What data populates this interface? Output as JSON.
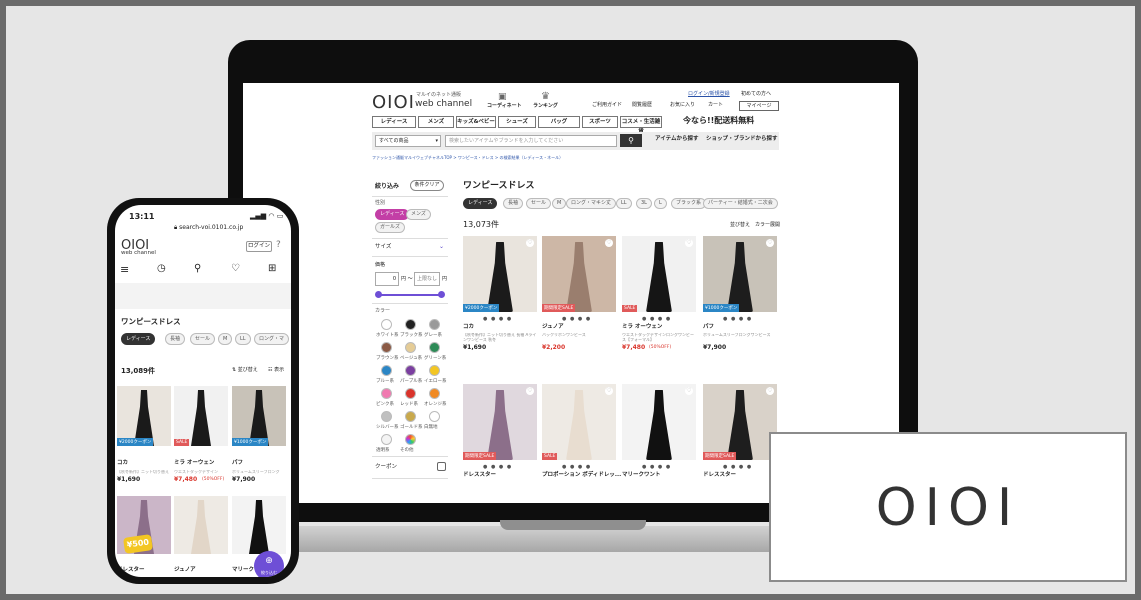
{
  "brand": {
    "logo": "OIOI",
    "sub": "web channel",
    "tag": "マルイのネット通販"
  },
  "desktop": {
    "header_links": [
      "ログイン/新規登録",
      "初めての方へ"
    ],
    "tools": [
      "コーディネート",
      "ランキング"
    ],
    "util": [
      "ご利用ガイド",
      "閲覧履歴",
      "お気に入り",
      "カート",
      "マイページ"
    ],
    "nav": [
      "レディース",
      "メンズ",
      "キッズ&ベビー",
      "シューズ",
      "バッグ",
      "スポーツ",
      "コスメ・生活雑貨"
    ],
    "shipping": "今なら!!配送料無料",
    "category_select": "すべての商品",
    "search_placeholder": "検索したいアイテムやブランドを入力してください",
    "search_links": [
      "アイテムから探す",
      "ショップ・ブランドから探す"
    ],
    "breadcrumb": "ファッション通販マルイウェブチャネルTOP > ワンピース・ドレス > の検索結果（レディース・ネール）",
    "filter_title": "絞り込み",
    "filter_clear": "条件クリア",
    "gender_label": "性別",
    "gender_tags": [
      "レディース",
      "メンズ",
      "ガールズ"
    ],
    "size_label": "サイズ",
    "price_label": "価格",
    "price_min": "0",
    "price_sep": "円 〜",
    "price_max": "上限なし",
    "price_unit": "円",
    "color_label": "カラー",
    "colors": [
      {
        "name": "ホワイト系",
        "hex": "#ffffff"
      },
      {
        "name": "ブラック系",
        "hex": "#222222"
      },
      {
        "name": "グレー系",
        "hex": "#999999"
      },
      {
        "name": "ブラウン系",
        "hex": "#8b5a45"
      },
      {
        "name": "ベージュ系",
        "hex": "#e5cc96"
      },
      {
        "name": "グリーン系",
        "hex": "#2e8b57"
      },
      {
        "name": "ブルー系",
        "hex": "#2b86c5"
      },
      {
        "name": "パープル系",
        "hex": "#7b3fa0"
      },
      {
        "name": "イエロー系",
        "hex": "#f3c623"
      },
      {
        "name": "ピンク系",
        "hex": "#f07ab0"
      },
      {
        "name": "レッド系",
        "hex": "#d9342b"
      },
      {
        "name": "オレンジ系",
        "hex": "#f08a24"
      },
      {
        "name": "シルバー系",
        "hex": "#c0c0c0"
      },
      {
        "name": "ゴールド系",
        "hex": "#c9a94c"
      },
      {
        "name": "白無地",
        "hex": "#ffffff"
      },
      {
        "name": "透明系",
        "hex": "#f4f4f4"
      },
      {
        "name": "その他",
        "hex": "#ff9f43"
      }
    ],
    "coupon_label": "クーポン",
    "page_title": "ワンピースドレス",
    "chips": [
      "レディース",
      "長袖",
      "セール",
      "M",
      "ロング・マキシ丈",
      "LL",
      "3L",
      "L",
      "ブラック系",
      "パーティー・結婚式・二次会"
    ],
    "result_count": "13,073件",
    "sort_links": [
      "並び替え",
      "カラー展開"
    ],
    "products": [
      {
        "brand": "コカ",
        "desc": "【秋冬新作】ニット切り替え 長袖 Aラインワンピース 秋冬",
        "price": "¥1,690",
        "discount": "",
        "badge": "¥2000クーポン",
        "badge_color": "#2b86c5",
        "bg": "#e9e4dd",
        "dress": "#1b1b1b"
      },
      {
        "brand": "ジュノア",
        "desc": "バックリボンワンピース",
        "price": "¥2,200",
        "discount": "",
        "badge": "期間限定SALE",
        "badge_color": "#e05a5a",
        "bg": "#cdb7a6",
        "dress": "#9a7e6e"
      },
      {
        "brand": "ミラ オーウェン",
        "desc": "ウエストタックデザインロングワンピース【フォーマル】",
        "price": "¥7,480",
        "discount": "(50%OFF)",
        "badge": "SALE",
        "badge_color": "#e05a5a",
        "bg": "#f1f1f1",
        "dress": "#151515"
      },
      {
        "brand": "パフ",
        "desc": "ボリュームスリーブロングワンピース",
        "price": "¥7,900",
        "discount": "",
        "badge": "¥1000クーポン",
        "badge_color": "#2b86c5",
        "bg": "#c8c2b8",
        "dress": "#1d1d1d"
      },
      {
        "brand": "ドレススター",
        "desc": "",
        "price": "",
        "discount": "",
        "badge": "期間限定SALE",
        "badge_color": "#e05a5a",
        "bg": "#e0d8de",
        "dress": "#8c6f8a"
      },
      {
        "brand": "プロポーション ボディドレッ...",
        "desc": "",
        "price": "",
        "discount": "",
        "badge": "SALE",
        "badge_color": "#e05a5a",
        "bg": "#eeeae4",
        "dress": "#e8ddd0"
      },
      {
        "brand": "マリークワント",
        "desc": "",
        "price": "",
        "discount": "",
        "badge": "",
        "badge_color": "#e05a5a",
        "bg": "#f3f3f3",
        "dress": "#111111"
      },
      {
        "brand": "ドレススター",
        "desc": "",
        "price": "",
        "discount": "",
        "badge": "期間限定SALE",
        "badge_color": "#e05a5a",
        "bg": "#d9d2c9",
        "dress": "#1e1e1e"
      }
    ]
  },
  "mobile": {
    "time": "13:11",
    "url": "search-voi.0101.co.jp",
    "login": "ログイン",
    "page_title": "ワンピースドレス",
    "chips": [
      "レディース",
      "長袖",
      "セール",
      "M",
      "LL",
      "ロング・マ"
    ],
    "result_count": "13,089件",
    "sort": "並び替え",
    "display": "表示",
    "products": [
      {
        "brand": "コカ",
        "desc": "【秋冬新作】ニット切り替え",
        "price": "¥1,690",
        "discount": "",
        "badge": "¥2000クーポン",
        "badge_color": "#2b86c5"
      },
      {
        "brand": "ミラ オーウェン",
        "desc": "ウエストタックデザイン",
        "price": "¥7,480",
        "discount": "(50%OFF)",
        "badge": "SALE",
        "badge_color": "#e05a5a"
      },
      {
        "brand": "パフ",
        "desc": "ボリュームスリーブロング",
        "price": "¥7,900",
        "discount": "",
        "badge": "¥1000クーポン",
        "badge_color": "#2b86c5"
      }
    ],
    "row2_names": [
      "ドレスター",
      "ジュノア",
      "マリークワ"
    ],
    "coupon_badge": "¥500",
    "fab_label": "絞り込む"
  },
  "logo_card": "OIOI"
}
